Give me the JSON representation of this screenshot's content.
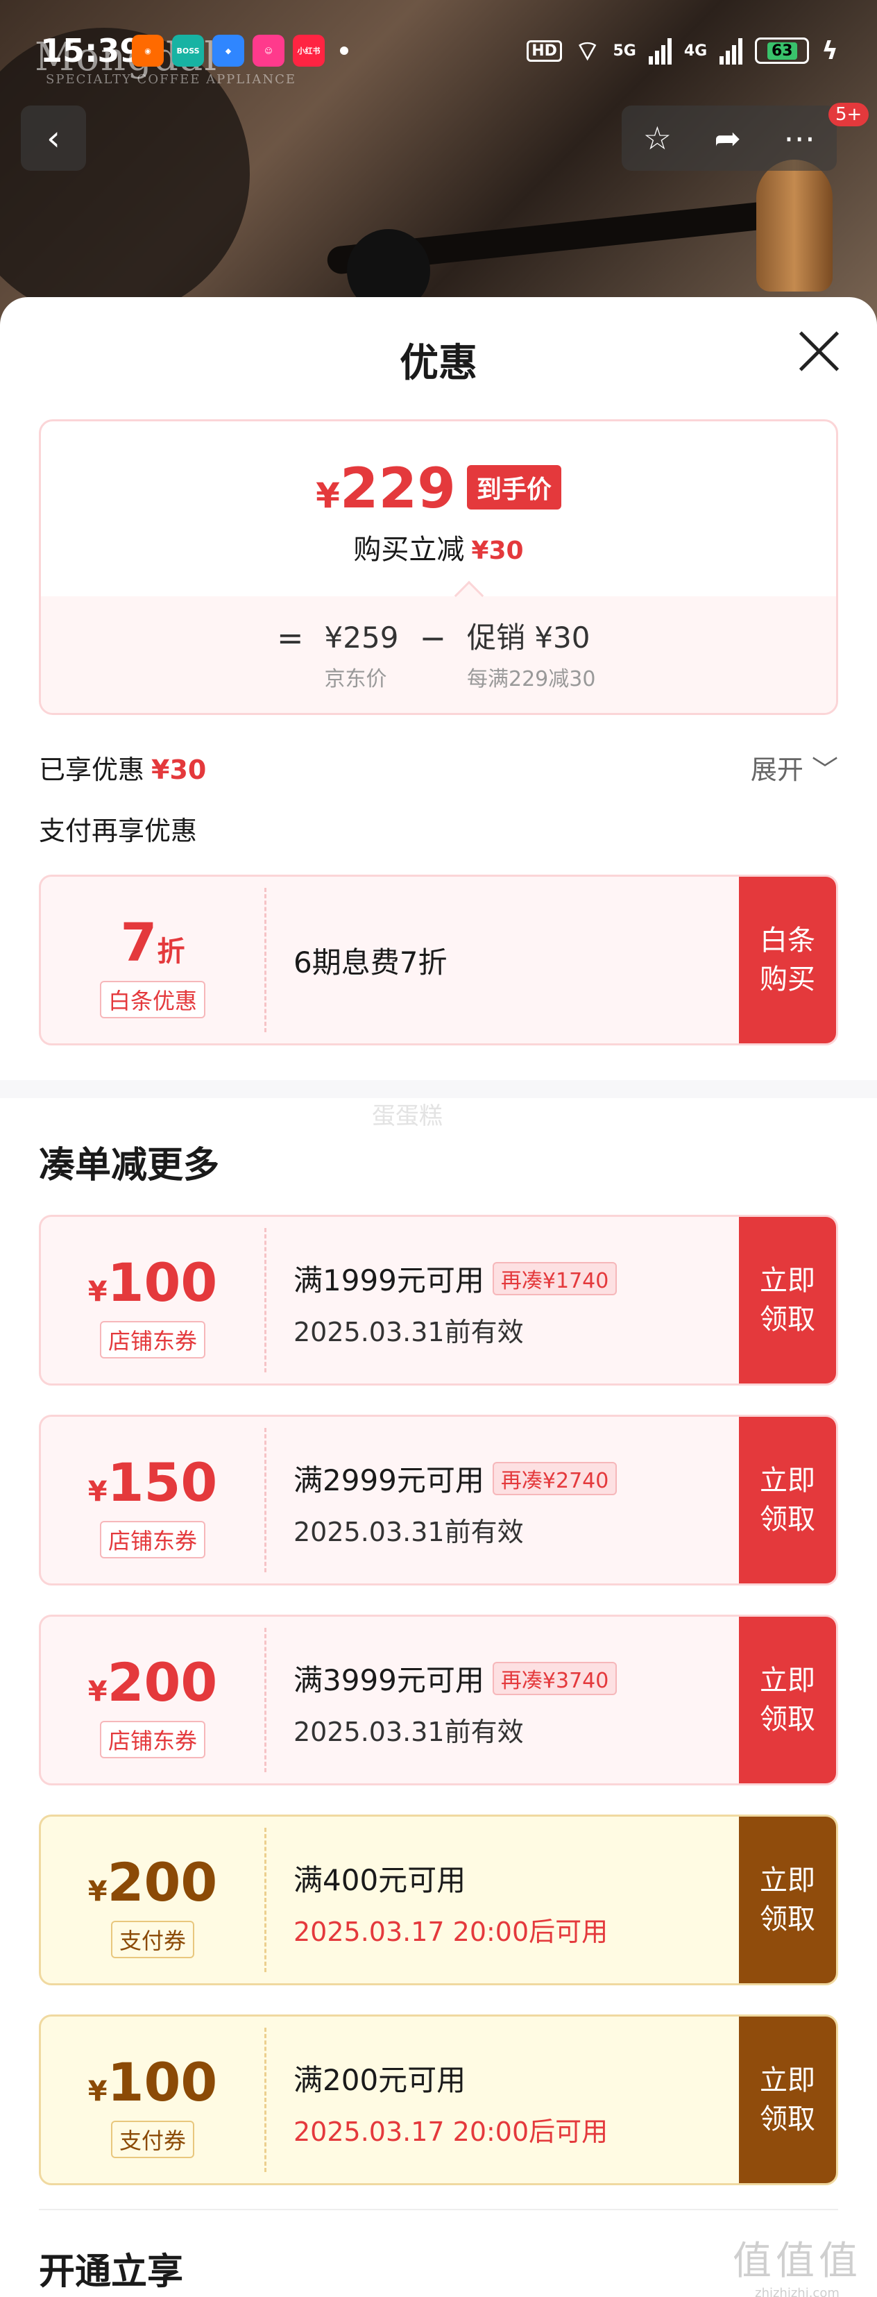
{
  "status_bar": {
    "time": "15:39",
    "app_icons": [
      {
        "name": "weibo-icon",
        "label": "",
        "color": "#ff6a00"
      },
      {
        "name": "boss-icon",
        "label": "BOSS\n直聘",
        "color": "#17b3a3"
      },
      {
        "name": "browser-icon",
        "label": "",
        "color": "#2f86ff"
      },
      {
        "name": "app-icon-pink",
        "label": "",
        "color": "#ff3a8c"
      },
      {
        "name": "xiaohongshu-icon",
        "label": "小红书",
        "color": "#ff2442"
      }
    ],
    "hd": "HD",
    "net1": "5G",
    "net2": "4G",
    "battery": "63"
  },
  "header": {
    "brand": "Mongdal",
    "brand_sub": "SPECIALTY COFFEE APPLIANCE",
    "notif_count": "5+"
  },
  "sheet": {
    "title": "优惠",
    "price_card": {
      "yen": "¥",
      "final_price": "229",
      "final_tag": "到手价",
      "reduce_label": "购买立减",
      "reduce_value": "¥30",
      "eq": "=",
      "base_price": "¥259",
      "base_label": "京东价",
      "minus": "−",
      "promo_value": "促销 ¥30",
      "promo_label": "每满229减30"
    },
    "enjoyed_label": "已享优惠",
    "enjoyed_value": "¥30",
    "expand_label": "展开 ﹀",
    "pay_more": "支付再享优惠",
    "baitiao": {
      "amount": "7",
      "unit": "折",
      "tag": "白条优惠",
      "desc": "6期息费7折",
      "button": "白条\n购买"
    },
    "watermark": "蛋蛋糕",
    "more_title": "凑单减更多",
    "coupons": [
      {
        "amount": "100",
        "tag": "店铺东券",
        "cond": "满1999元可用",
        "pill": "再凑¥1740",
        "valid": "2025.03.31前有效",
        "button": "立即\n领取"
      },
      {
        "amount": "150",
        "tag": "店铺东券",
        "cond": "满2999元可用",
        "pill": "再凑¥2740",
        "valid": "2025.03.31前有效",
        "button": "立即\n领取"
      },
      {
        "amount": "200",
        "tag": "店铺东券",
        "cond": "满3999元可用",
        "pill": "再凑¥3740",
        "valid": "2025.03.31前有效",
        "button": "立即\n领取"
      }
    ],
    "pay_coupons": [
      {
        "amount": "200",
        "tag": "支付券",
        "cond": "满400元可用",
        "valid": "2025.03.17 20:00后可用",
        "button": "立即\n领取"
      },
      {
        "amount": "100",
        "tag": "支付券",
        "cond": "满200元可用",
        "valid": "2025.03.17 20:00后可用",
        "button": "立即\n领取"
      }
    ],
    "open_title": "开通立享",
    "site_mark": "值值值",
    "site_mark_small": "zhizhizhi.com"
  }
}
